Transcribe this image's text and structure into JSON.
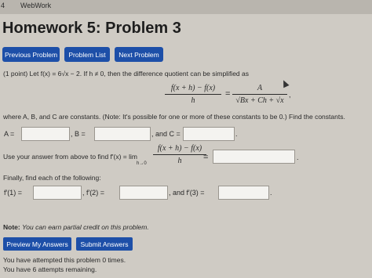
{
  "topbar": {
    "tab_number": "4",
    "app_name": "WebWork"
  },
  "page": {
    "title": "Homework 5: Problem 3"
  },
  "nav": {
    "previous": "Previous Problem",
    "list": "Problem List",
    "next": "Next Problem"
  },
  "problem": {
    "intro": "(1 point) Let f(x) = 6√x − 2. If h ≠ 0, then the difference quotient can be simplified as",
    "dq_num": "f(x + h) − f(x)",
    "dq_den": "h",
    "eq": "=",
    "rhs_num": "A",
    "rhs_den": "√Bx + Ch + √x",
    "rhs_comma": ",",
    "where_text": "where A, B, and C are constants. (Note: It's possible for one or more of these constants to be 0.) Find the constants.",
    "label_A": "A =",
    "label_B": ", B =",
    "label_C": ", and C =",
    "period1": ".",
    "use_text": "Use your answer from above to find f′(x) = lim",
    "lim_sub": "h→0",
    "lim_num": "f(x + h) − f(x)",
    "lim_den": "h",
    "eq2": "=",
    "period2": ".",
    "finally_text": "Finally, find each of the following:",
    "label_f1": "f′(1) =",
    "label_f2": ", f′(2) =",
    "label_f3": ", and f′(3) =",
    "period3": "."
  },
  "note": {
    "bold": "Note:",
    "italic": "You can earn partial credit on this problem."
  },
  "actions": {
    "preview": "Preview My Answers",
    "submit": "Submit Answers"
  },
  "status": {
    "attempted": "You have attempted this problem 0 times.",
    "remaining": "You have 6 attempts remaining."
  },
  "colors": {
    "button": "#1d4fa8",
    "background": "#cfcbc4"
  }
}
